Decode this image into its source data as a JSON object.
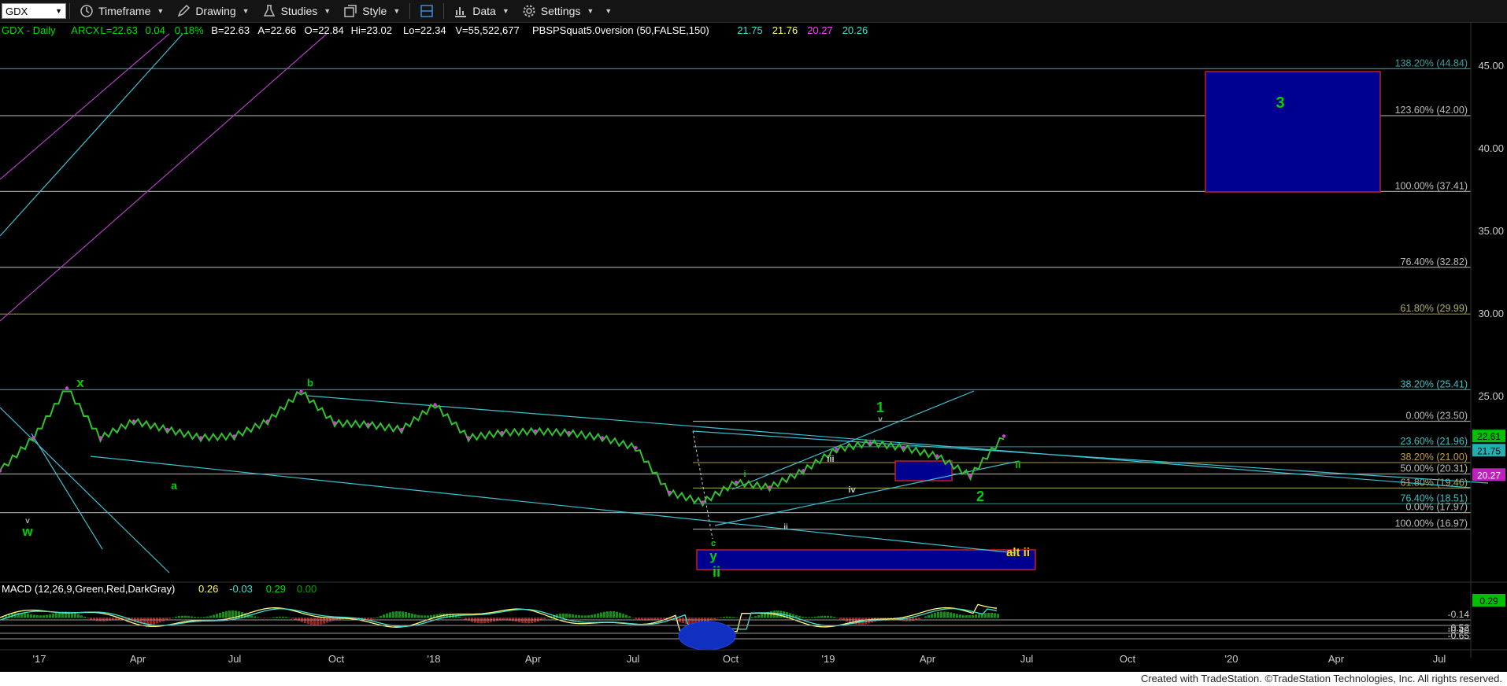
{
  "toolbar": {
    "symbol": "GDX",
    "timeframe": "Timeframe",
    "drawing": "Drawing",
    "studies": "Studies",
    "style": "Style",
    "data": "Data",
    "settings": "Settings",
    "icons": [
      "timeframe-icon",
      "drawing-icon",
      "studies-icon",
      "style-icon",
      "layout-icon",
      "data-icon",
      "settings-icon"
    ]
  },
  "header": {
    "items": [
      {
        "text": "GDX - Daily",
        "color": "#00e000"
      },
      {
        "text": "ARCX",
        "color": "#00e000"
      },
      {
        "text": "L=22.63",
        "color": "#00e000"
      },
      {
        "text": "0.04",
        "color": "#00e000"
      },
      {
        "text": "0.18%",
        "color": "#00e000"
      },
      {
        "text": "B=22.63",
        "color": "#ffffff"
      },
      {
        "text": "A=22.66",
        "color": "#ffffff"
      },
      {
        "text": "O=22.84",
        "color": "#ffffff"
      },
      {
        "text": "Hi=23.02",
        "color": "#ffffff"
      },
      {
        "text": "Lo=22.34",
        "color": "#ffffff"
      },
      {
        "text": "V=55,522,677",
        "color": "#ffffff"
      },
      {
        "text": "PBSPSquat5.0version (50,FALSE,150)",
        "color": "#ffffff"
      },
      {
        "text": "21.75",
        "color": "#40e0d0"
      },
      {
        "text": "21.76",
        "color": "#ffff66"
      },
      {
        "text": "20.27",
        "color": "#ff40ff"
      },
      {
        "text": "20.26",
        "color": "#40e0d0"
      }
    ]
  },
  "price_axis": {
    "ticks": [
      "45.00",
      "40.00",
      "35.00",
      "30.00",
      "25.00"
    ],
    "badges": [
      {
        "text": "22.61",
        "bg": "#00c000",
        "fg": "#000000",
        "price": 22.61
      },
      {
        "text": "21.75",
        "bg": "#20b0b0",
        "fg": "#000000",
        "price": 21.75
      },
      {
        "text": "20.27",
        "bg": "#c020c0",
        "fg": "#ffffff",
        "price": 20.27
      }
    ]
  },
  "fib_levels": [
    {
      "label": "138.20% (44.84)",
      "price": 44.84,
      "color": "#3aa0a0"
    },
    {
      "label": "123.60% (42.00)",
      "price": 42.0,
      "color": "#bbbbbb"
    },
    {
      "label": "100.00% (37.41)",
      "price": 37.41,
      "color": "#bbbbbb"
    },
    {
      "label": "76.40% (32.82)",
      "price": 32.82,
      "color": "#bbbbbb"
    },
    {
      "label": "61.80% (29.99)",
      "price": 29.99,
      "color": "#b0b060"
    },
    {
      "label": "38.20% (25.41)",
      "price": 25.41,
      "color": "#40c0c0"
    },
    {
      "label": "0.00% (23.50)",
      "price": 23.5,
      "color": "#bbbbbb"
    },
    {
      "label": "23.60% (21.96)",
      "price": 21.96,
      "color": "#40c0c0"
    },
    {
      "label": "38.20% (21.00)",
      "price": 21.0,
      "color": "#c0a040"
    },
    {
      "label": "50.00% (20.31)",
      "price": 20.31,
      "color": "#bbbbbb"
    },
    {
      "label": "61.80% (19.46)",
      "price": 19.46,
      "color": "#b0b060"
    },
    {
      "label": "76.40% (18.51)",
      "price": 18.51,
      "color": "#40c0c0"
    },
    {
      "label": "0.00% (17.97)",
      "price": 17.97,
      "color": "#bbbbbb"
    },
    {
      "label": "100.00% (16.97)",
      "price": 16.97,
      "color": "#bbbbbb"
    }
  ],
  "wave_labels": [
    {
      "text": "x",
      "color": "#00d000"
    },
    {
      "text": "b",
      "color": "#00d000"
    },
    {
      "text": "a",
      "color": "#00d000"
    },
    {
      "text": "w",
      "color": "#00d000"
    },
    {
      "text": "v",
      "color": "#aaaaaa"
    },
    {
      "text": "c",
      "color": "#00d000"
    },
    {
      "text": "y",
      "color": "#00d000"
    },
    {
      "text": "ii",
      "color": "#00d000"
    },
    {
      "text": "1",
      "color": "#00d000"
    },
    {
      "text": "v",
      "color": "#aaaaaa"
    },
    {
      "text": "i",
      "color": "#00d000"
    },
    {
      "text": "ii",
      "color": "#00d000"
    },
    {
      "text": "2",
      "color": "#00d000"
    },
    {
      "text": "3",
      "color": "#00d000"
    },
    {
      "text": "i",
      "color": "#cccccc"
    },
    {
      "text": "iii",
      "color": "#cccccc"
    },
    {
      "text": "iv",
      "color": "#cccccc"
    },
    {
      "text": "ii",
      "color": "#cccccc"
    },
    {
      "text": "alt ii",
      "color": "#ffd700"
    }
  ],
  "macd": {
    "title": "MACD (12,26,9,Green,Red,DarkGray)",
    "values": [
      {
        "text": "0.26",
        "color": "#ffff66"
      },
      {
        "text": "-0.03",
        "color": "#40e0d0"
      },
      {
        "text": "0.29",
        "color": "#00e000"
      },
      {
        "text": "0.00",
        "color": "#00a000"
      }
    ],
    "axis": [
      "-0.14",
      "-0.40",
      "-0.52",
      "-0.65"
    ],
    "badge": "0.29"
  },
  "time_axis": [
    "'17",
    "Apr",
    "Jul",
    "Oct",
    "'18",
    "Apr",
    "Jul",
    "Oct",
    "'19",
    "Apr",
    "Jul",
    "Oct",
    "'20",
    "Apr",
    "Jul"
  ],
  "footer": "Created with TradeStation. ©TradeStation Technologies, Inc. All rights reserved.",
  "chart_data": {
    "type": "line",
    "symbol": "GDX",
    "interval": "Daily",
    "price_range": [
      13.5,
      46.5
    ],
    "x": [
      "2016-12",
      "2017-01",
      "2017-02",
      "2017-03",
      "2017-04",
      "2017-05",
      "2017-06",
      "2017-07",
      "2017-08",
      "2017-09",
      "2017-10",
      "2017-11",
      "2017-12",
      "2018-01",
      "2018-02",
      "2018-03",
      "2018-04",
      "2018-05",
      "2018-06",
      "2018-07",
      "2018-08",
      "2018-09",
      "2018-10",
      "2018-11",
      "2018-12",
      "2019-01",
      "2019-02",
      "2019-03",
      "2019-04",
      "2019-05",
      "2019-06"
    ],
    "series": [
      {
        "values": [
          20.5,
          22.5,
          25.5,
          22.5,
          23.5,
          23.0,
          22.5,
          22.6,
          23.5,
          25.3,
          23.4,
          23.3,
          23.0,
          24.5,
          22.5,
          22.8,
          22.9,
          22.8,
          22.5,
          21.9,
          19.2,
          18.6,
          19.8,
          19.5,
          20.5,
          21.8,
          22.2,
          21.9,
          21.4,
          20.2,
          22.6
        ]
      }
    ],
    "macd_range": [
      -0.75,
      0.45
    ]
  }
}
